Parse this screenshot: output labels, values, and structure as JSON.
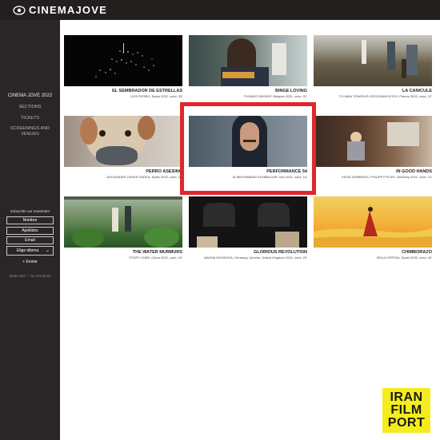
{
  "header": {
    "brand": "CINEMAJOVE"
  },
  "sidebar": {
    "title": "CINEMA JOVE 2022",
    "links": [
      "SECTIONS",
      "TICKETS",
      "SCREENINGS AND",
      "VENUES"
    ],
    "subscribe": "Subscribe our newsletter",
    "fields": {
      "nombre": "Nombre",
      "apellidos": "Apellidos",
      "email": "Email"
    },
    "language_select": "Elige idioma",
    "send": "+ Enviar",
    "made_with": "Made with ♡ by Wonderly"
  },
  "films": [
    {
      "title": "EL SEMBRADOR DE ESTRELLAS",
      "meta": "LOIS PATIÑO, Spain 2022, color, 25'"
    },
    {
      "title": "BINGE LOVING",
      "meta": "THOMAS DEKNOP, Belgium 2021, color, 22'"
    },
    {
      "title": "LA CANICULE",
      "meta": "TYLIANN TONDEUR-GROZDANOVITCH, France 2022, color, 12'"
    },
    {
      "title": "PERRO ASESINO",
      "meta": "ALEXANDER LEMUS GADEA, Spain 2022, color, 20'"
    },
    {
      "title": "PERFORMANCE 54",
      "meta": "ALIMOHAMMAD EGHBALDAR, Iran 2021, color, 14'"
    },
    {
      "title": "IN GOOD HANDS",
      "meta": "KEZIA ZURBRIGG, PHILIPP FITLER, Germany 2021, color, 14'"
    },
    {
      "title": "THE WATER MURMURS",
      "meta": "STORY CHEN, China 2022, color, 15'"
    },
    {
      "title": "GLORIOUS REVOLUTION",
      "meta": "MASHA NOVIKOVA, Germany, Ukraine, United Kingdom 2021, color, 20'"
    },
    {
      "title": "CHIMBORAZO",
      "meta": "KELIA CEPEDA, Spain 2022, color, 15'"
    }
  ],
  "watermark": {
    "line1": "IRAN",
    "line2": "FILM",
    "line3": "PORT"
  },
  "colors": {
    "highlight": "#e0262c",
    "sidebar": "#2a2526",
    "badge": "#f4ec1c"
  }
}
